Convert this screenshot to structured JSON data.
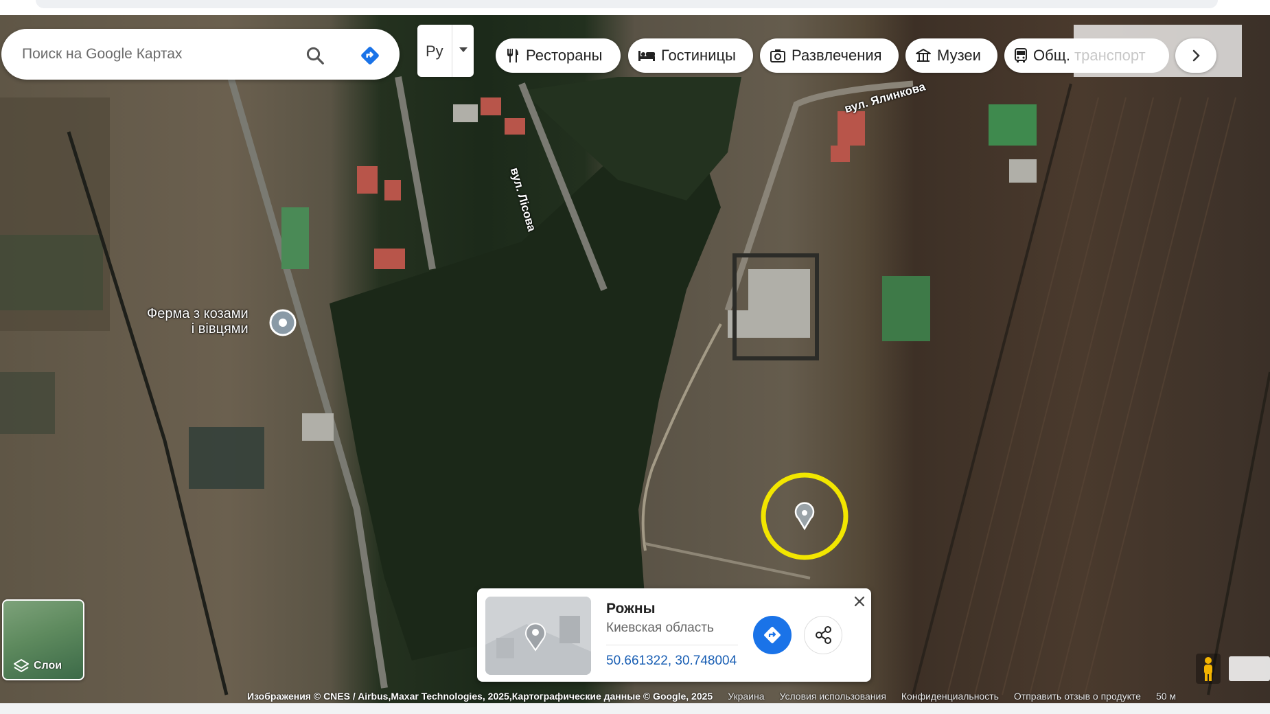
{
  "search": {
    "placeholder": "Поиск на Google Картах"
  },
  "lang": {
    "label": "Ру"
  },
  "chips": [
    {
      "label": "Рестораны",
      "icon": "restaurant-icon"
    },
    {
      "label": "Гостиницы",
      "icon": "hotel-icon"
    },
    {
      "label": "Развлечения",
      "icon": "camera-icon"
    },
    {
      "label": "Музеи",
      "icon": "museum-icon"
    },
    {
      "label": "Общ. транспорт",
      "icon": "transit-icon"
    }
  ],
  "map": {
    "poi": {
      "line1": "Ферма з козами",
      "line2": "і вівцями"
    },
    "streets": {
      "lisova": "вул. Лісова",
      "yalynkova": "вул. Ялинкова"
    },
    "highlight_color": "#f2e600"
  },
  "card": {
    "title": "Рожны",
    "region": "Киевская область",
    "coords": "50.661322, 30.748004"
  },
  "layers": {
    "label": "Слои"
  },
  "attribution": {
    "main": "Изображения © CNES / Airbus,Maxar Technologies, 2025,Картографические данные © Google, 2025",
    "country": "Украина",
    "terms": "Условия использования",
    "privacy": "Конфиденциальность",
    "feedback": "Отправить отзыв о продукте",
    "scale": "50 м"
  }
}
